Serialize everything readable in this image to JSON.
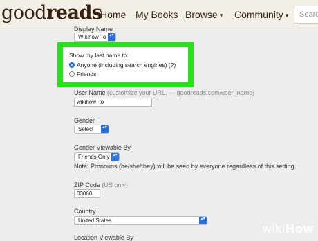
{
  "header": {
    "logo_light": "good",
    "logo_bold": "reads",
    "nav": [
      "Home",
      "My Books",
      "Browse",
      "Community"
    ],
    "caret": "▾",
    "search_placeholder": "Searc"
  },
  "form": {
    "display_name_label": "Display Name",
    "display_name_value": "Wikihow To",
    "last_name": {
      "label": "Show my last name to:",
      "options": [
        "Anyone (including search engines) (?)",
        "Friends"
      ],
      "selected": 0
    },
    "username_label": "User Name",
    "username_hint": "(customize your URL. — goodreads.com/user_name)",
    "username_value": "wikihow_to",
    "gender_label": "Gender",
    "gender_value": "Select",
    "gender_viewable_label": "Gender Viewable By",
    "gender_viewable_value": "Friends Only",
    "pronoun_note": "Note: Pronouns (he/she/they) will be seen by everyone regardless of this setting.",
    "zip_label": "ZIP Code",
    "zip_hint": "(US only)",
    "zip_value": "03060",
    "country_label": "Country",
    "country_value": "United States",
    "location_label": "Location Viewable By"
  },
  "select_arrows": "▴▾",
  "watermark": {
    "a": "wiki",
    "b": "How"
  },
  "colors": {
    "highlight": "#24e317",
    "select_accent": "#2a6fde"
  }
}
